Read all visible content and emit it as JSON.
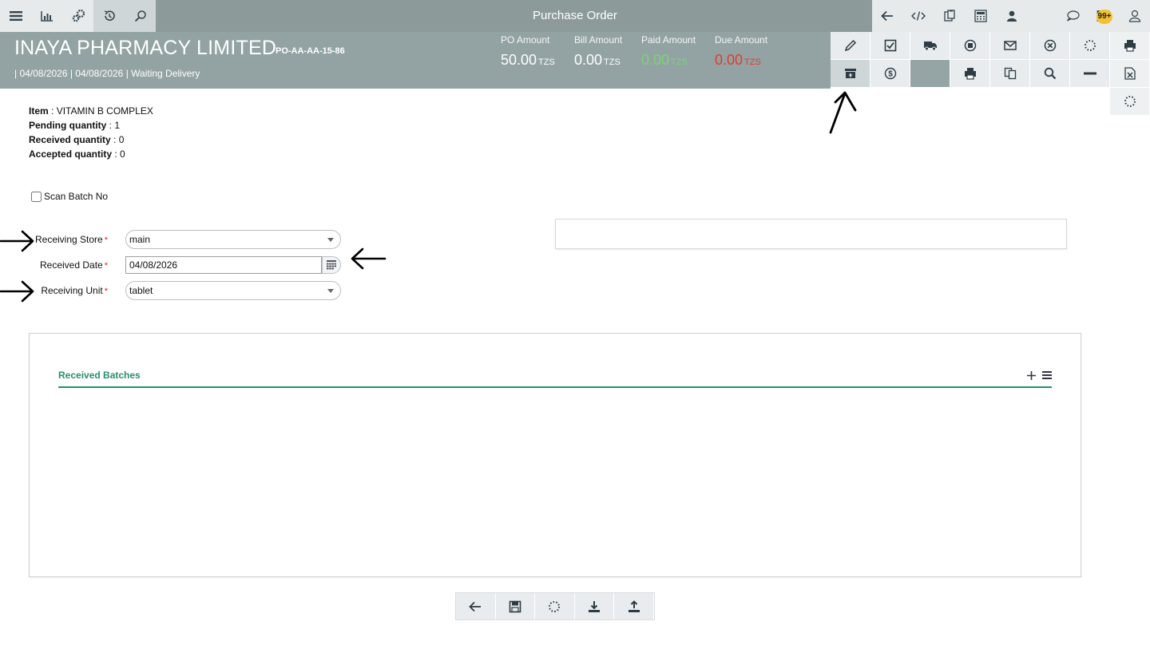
{
  "topbar": {
    "title": "Purchase Order",
    "left_icons": [
      "menu-icon",
      "chart-icon",
      "settings-gears-icon",
      "history-icon",
      "search-icon"
    ],
    "right_icons": [
      "back-arrow-icon",
      "code-icon",
      "clipboard-icon",
      "calculator-icon",
      "user-group-icon",
      "chat-icon",
      "mail-icon",
      "user-icon"
    ],
    "notification_count": "99+"
  },
  "header": {
    "company": "INAYA PHARMACY LIMITED",
    "po_number": "PO-AA-AA-15-86",
    "subline": "| 04/08/2026 | 04/08/2026 | Waiting Delivery",
    "amounts": {
      "po": {
        "label": "PO Amount",
        "value": "50.00",
        "currency": "TZS"
      },
      "bill": {
        "label": "Bill Amount",
        "value": "0.00",
        "currency": "TZS"
      },
      "paid": {
        "label": "Paid Amount",
        "value": "0.00",
        "currency": "TZS"
      },
      "due": {
        "label": "Due Amount",
        "value": "0.00",
        "currency": "TZS"
      }
    },
    "colors": {
      "paid": "#7bd37b",
      "due": "#e03b2f"
    }
  },
  "actions": {
    "row1": [
      "edit-icon",
      "checkbox-approve-icon",
      "truck-delivery-icon",
      "stop-icon",
      "email-icon",
      "cancel-icon",
      "loading-icon",
      "print-icon"
    ],
    "row2": [
      "receive-inbox-icon",
      "payment-dollar-icon",
      "",
      "print-icon",
      "copy-icon",
      "search-icon",
      "minus-icon",
      "excel-export-icon"
    ],
    "extra": "loading-icon"
  },
  "item": {
    "item_label": "Item",
    "item_value": "VITAMIN B COMPLEX",
    "pending_label": "Pending quantity",
    "pending_value": "1",
    "received_label": "Received quantity",
    "received_value": "0",
    "accepted_label": "Accepted quantity",
    "accepted_value": "0"
  },
  "scan_batch": {
    "label": "Scan Batch No",
    "checked": false
  },
  "form": {
    "receiving_store": {
      "label": "Receiving Store",
      "value": "main"
    },
    "received_date": {
      "label": "Received Date",
      "value": "04/08/2026"
    },
    "receiving_unit": {
      "label": "Receiving Unit",
      "value": "tablet"
    },
    "required_mark": "*"
  },
  "batches": {
    "title": "Received Batches",
    "accent": "#2b8c6e"
  },
  "bottom_toolbar": [
    "back-arrow-icon",
    "save-icon",
    "loading-icon",
    "download-icon",
    "upload-icon"
  ]
}
